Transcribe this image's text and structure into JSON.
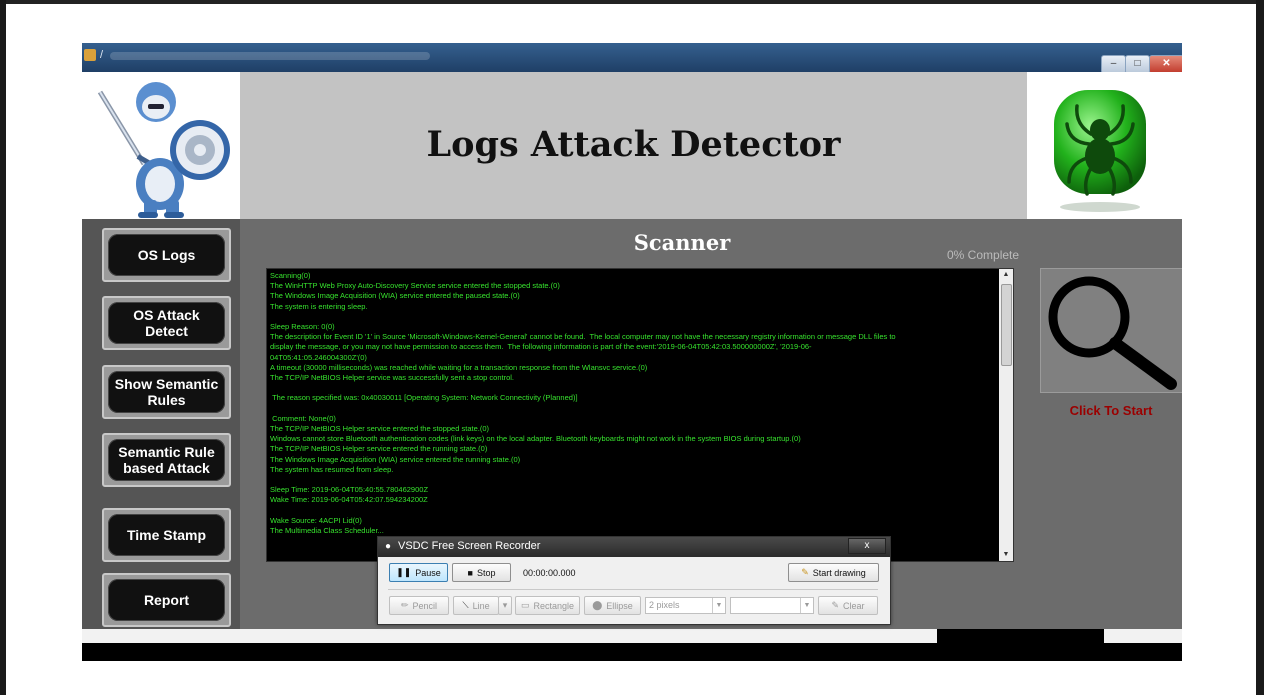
{
  "window": {
    "title": "/"
  },
  "header": {
    "app_title": "Logs Attack Detector"
  },
  "nav": {
    "items": [
      {
        "label": "OS Logs"
      },
      {
        "label": "OS Attack\nDetect"
      },
      {
        "label": "Show Semantic\nRules"
      },
      {
        "label": "Semantic Rule\nbased Attack"
      },
      {
        "label": "Time Stamp"
      },
      {
        "label": "Report"
      }
    ]
  },
  "scanner": {
    "title": "Scanner",
    "progress_text": "0% Complete",
    "progress_percent": 0,
    "log_lines": [
      "Scanning(0)",
      "The WinHTTP Web Proxy Auto-Discovery Service service entered the stopped state.(0)",
      "The Windows Image Acquisition (WIA) service entered the paused state.(0)",
      "The system is entering sleep.",
      "",
      "Sleep Reason: 0(0)",
      "The description for Event ID '1' in Source 'Microsoft-Windows-Kernel-General' cannot be found.  The local computer may not have the necessary registry information or message DLL files to",
      "display the message, or you may not have permission to access them.  The following information is part of the event:'2019-06-04T05:42:03.500000000Z', '2019-06-",
      "04T05:41:05.246004300Z'(0)",
      "A timeout (30000 milliseconds) was reached while waiting for a transaction response from the Wlansvc service.(0)",
      "The TCP/IP NetBIOS Helper service was successfully sent a stop control.",
      "",
      " The reason specified was: 0x40030011 [Operating System: Network Connectivity (Planned)]",
      "",
      " Comment: None(0)",
      "The TCP/IP NetBIOS Helper service entered the stopped state.(0)",
      "Windows cannot store Bluetooth authentication codes (link keys) on the local adapter. Bluetooth keyboards might not work in the system BIOS during startup.(0)",
      "The TCP/IP NetBIOS Helper service entered the running state.(0)",
      "The Windows Image Acquisition (WIA) service entered the running state.(0)",
      "The system has resumed from sleep.",
      "",
      "Sleep Time: 2019-06-04T05:40:55.780462900Z",
      "Wake Time: 2019-06-04T05:42:07.594234200Z",
      "",
      "Wake Source: 4ACPI Lid(0)",
      "The Multimedia Class Scheduler..."
    ],
    "search_icon": "magnifier-icon",
    "click_to_start": "Click To Start"
  },
  "recorder": {
    "title": "VSDC Free Screen Recorder",
    "close_label": "x",
    "pause_label": "Pause",
    "stop_label": "Stop",
    "time": "00:00:00.000",
    "start_drawing_label": "Start drawing",
    "pencil_label": "Pencil",
    "line_label": "Line",
    "rectangle_label": "Rectangle",
    "ellipse_label": "Ellipse",
    "stroke_value": "2 pixels",
    "clear_label": "Clear"
  },
  "colors": {
    "log_text": "#37e32e",
    "click_to_start": "#9b0000",
    "title_panel": "#c3c3c3"
  }
}
